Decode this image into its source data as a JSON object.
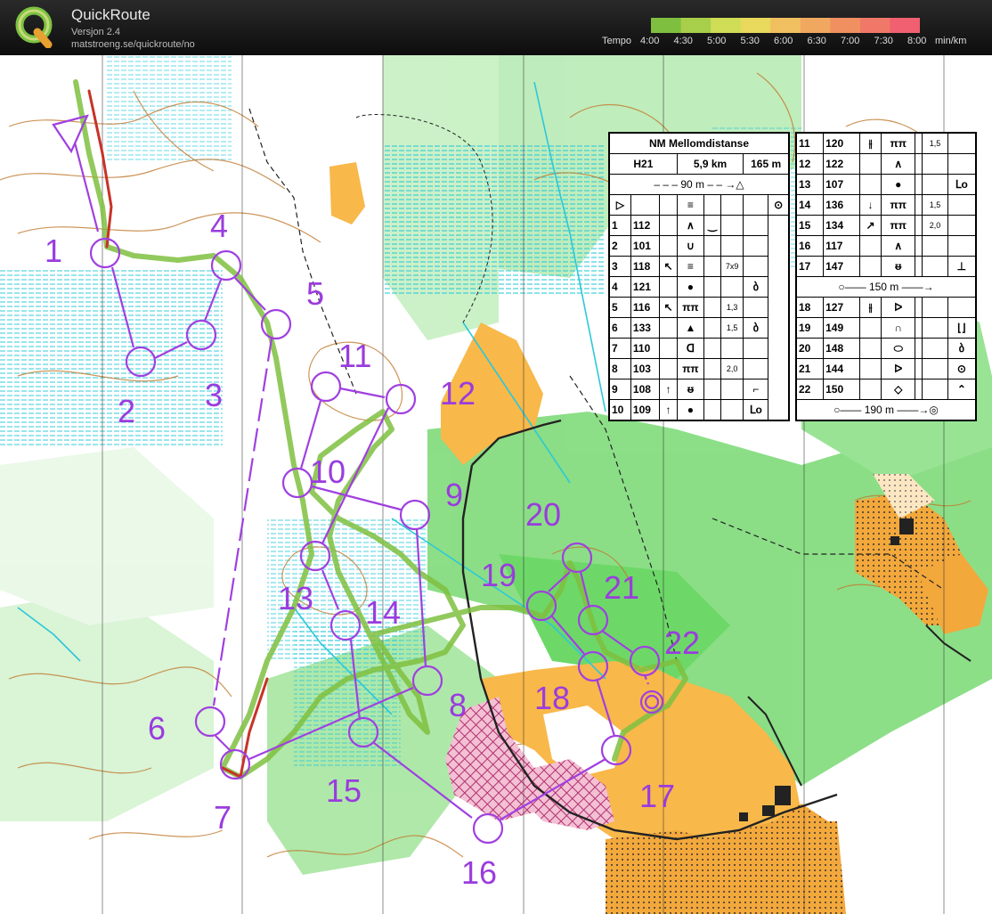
{
  "app": {
    "name": "QuickRoute",
    "version": "Versjon 2.4",
    "url": "matstroeng.se/quickroute/no"
  },
  "pace_legend": {
    "prefix": "Tempo",
    "labels": [
      "4:00",
      "4:30",
      "5:00",
      "5:30",
      "6:00",
      "6:30",
      "7:00",
      "7:30",
      "8:00"
    ],
    "unit": "min/km",
    "colors": [
      "#7fbf3f",
      "#a8cf4a",
      "#cfdc55",
      "#e8d85c",
      "#f0c060",
      "#f0a860",
      "#f09060",
      "#f07868",
      "#f06070"
    ]
  },
  "course": {
    "title": "NM Mellomdistanse",
    "class": "H21",
    "length": "5,9 km",
    "climb": "165 m",
    "start_marking": "90 m",
    "marking_mid": "150 m",
    "marking_finish": "190 m",
    "controls_left": [
      {
        "n": "1",
        "code": "112",
        "dir": "",
        "feature": "∧",
        "extra": "‿",
        "dim": "",
        "detail": ""
      },
      {
        "n": "2",
        "code": "101",
        "dir": "",
        "feature": "∪",
        "extra": "",
        "dim": "",
        "detail": ""
      },
      {
        "n": "3",
        "code": "118",
        "dir": "↖",
        "feature": "≡",
        "extra": "",
        "dim": "7x9",
        "detail": ""
      },
      {
        "n": "4",
        "code": "121",
        "dir": "",
        "feature": "●",
        "extra": "",
        "dim": "",
        "detail": "ბ"
      },
      {
        "n": "5",
        "code": "116",
        "dir": "↖",
        "feature": "ππ",
        "extra": "",
        "dim": "1,3",
        "detail": ""
      },
      {
        "n": "6",
        "code": "133",
        "dir": "",
        "feature": "▲",
        "extra": "",
        "dim": "1,5",
        "detail": "ბ"
      },
      {
        "n": "7",
        "code": "110",
        "dir": "",
        "feature": "ᗡ",
        "extra": "",
        "dim": "",
        "detail": ""
      },
      {
        "n": "8",
        "code": "103",
        "dir": "",
        "feature": "ππ",
        "extra": "",
        "dim": "2,0",
        "detail": ""
      },
      {
        "n": "9",
        "code": "108",
        "dir": "↑",
        "feature": "ᵿ",
        "extra": "",
        "dim": "",
        "detail": "⌐"
      },
      {
        "n": "10",
        "code": "109",
        "dir": "↑",
        "feature": "●",
        "extra": "",
        "dim": "",
        "detail": "ᒪo"
      }
    ],
    "controls_right": [
      {
        "n": "11",
        "code": "120",
        "dir": "⫲",
        "feature": "ππ",
        "extra": "",
        "dim": "1,5",
        "detail": ""
      },
      {
        "n": "12",
        "code": "122",
        "dir": "",
        "feature": "∧",
        "extra": "",
        "dim": "",
        "detail": ""
      },
      {
        "n": "13",
        "code": "107",
        "dir": "",
        "feature": "●",
        "extra": "",
        "dim": "",
        "detail": "ᒪo"
      },
      {
        "n": "14",
        "code": "136",
        "dir": "↓",
        "feature": "ππ",
        "extra": "",
        "dim": "1,5",
        "detail": ""
      },
      {
        "n": "15",
        "code": "134",
        "dir": "↗",
        "feature": "ππ",
        "extra": "",
        "dim": "2,0",
        "detail": ""
      },
      {
        "n": "16",
        "code": "117",
        "dir": "",
        "feature": "∧",
        "extra": "",
        "dim": "",
        "detail": ""
      },
      {
        "n": "17",
        "code": "147",
        "dir": "",
        "feature": "ᵿ",
        "extra": "",
        "dim": "",
        "detail": "⊥"
      },
      {
        "n": "18",
        "code": "127",
        "dir": "⫲",
        "feature": "ᐅ",
        "extra": "",
        "dim": "",
        "detail": ""
      },
      {
        "n": "19",
        "code": "149",
        "dir": "",
        "feature": "∩",
        "extra": "",
        "dim": "",
        "detail": "⌊⌋"
      },
      {
        "n": "20",
        "code": "148",
        "dir": "",
        "feature": "⬭",
        "extra": "",
        "dim": "",
        "detail": "ბ"
      },
      {
        "n": "21",
        "code": "144",
        "dir": "",
        "feature": "ᐅ",
        "extra": "",
        "dim": "",
        "detail": "⊙"
      },
      {
        "n": "22",
        "code": "150",
        "dir": "",
        "feature": "◇",
        "extra": "",
        "dim": "",
        "detail": "⌃"
      }
    ]
  },
  "map_labels": [
    "1",
    "2",
    "3",
    "4",
    "5",
    "6",
    "7",
    "8",
    "9",
    "10",
    "11",
    "12",
    "13",
    "14",
    "15",
    "16",
    "17",
    "18",
    "19",
    "20",
    "21",
    "22"
  ],
  "colors": {
    "course": "#a040e0",
    "route": "#c83228",
    "forest_green": "#6ed46e",
    "open_yellow": "#f8b84a",
    "contour": "#b0682a",
    "water_blue": "#2cc8d8"
  }
}
